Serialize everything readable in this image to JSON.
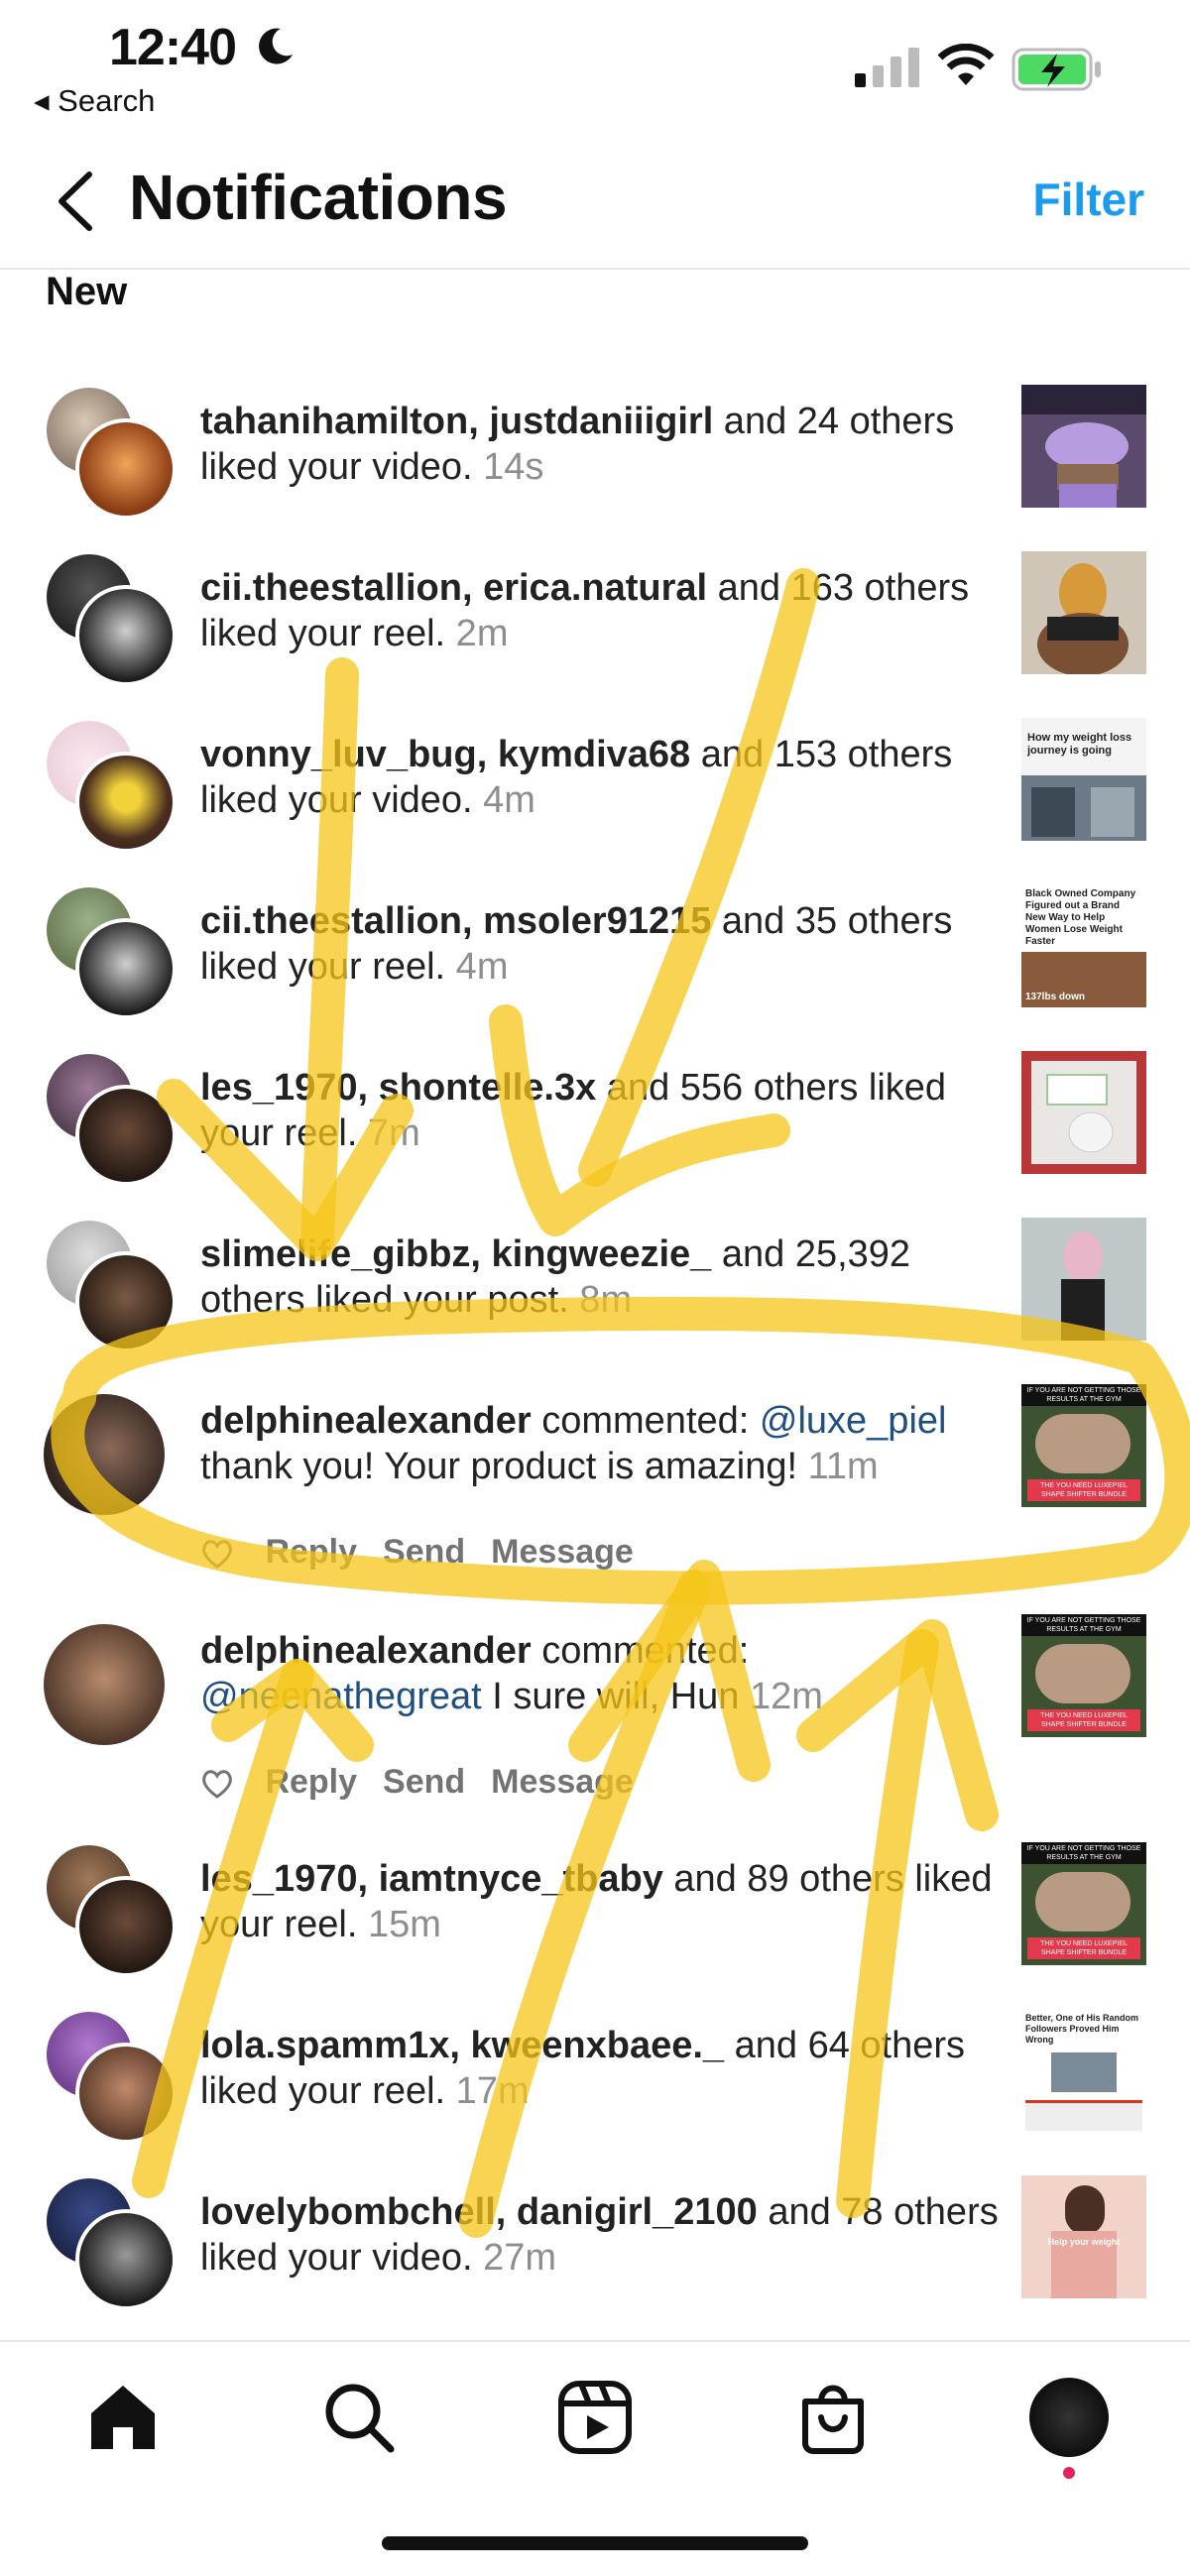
{
  "status_bar": {
    "time": "12:40",
    "back_label": "◂ Search"
  },
  "header": {
    "title": "Notifications",
    "filter": "Filter"
  },
  "section_title": "New",
  "notifications": [
    {
      "user": "tahanihamilton, justdaniiigirl",
      "text": " and 24 others liked your video.",
      "time": " 14s"
    },
    {
      "user": "cii.theestallion, erica.natural",
      "text": " and 163 others liked your reel.",
      "time": " 2m"
    },
    {
      "user": "vonny_luv_bug, kymdiva68",
      "text": " and 153 others liked your video.",
      "time": " 4m"
    },
    {
      "user": "cii.theestallion, msoler91215",
      "text": " and 35 others liked your reel.",
      "time": " 4m"
    },
    {
      "user": "les_1970, shontelle.3x",
      "text": " and 556 others liked your reel.",
      "time": " 7m"
    },
    {
      "user": "slimelife_gibbz, kingweezie_",
      "text": " and 25,392 others liked your post.",
      "time": " 8m"
    },
    {
      "user": "delphinealexander",
      "text": " commented: ",
      "mention": "@luxe_piel",
      "text2": " thank you! Your product is amazing!",
      "time": " 11m"
    },
    {
      "user": "delphinealexander",
      "text": " commented: ",
      "mention": "@neenathegreat",
      "text2": " I sure will, Hun",
      "time": " 12m"
    },
    {
      "user": "les_1970, iamtnyce_tbaby",
      "text": " and 89 others liked your reel.",
      "time": " 15m"
    },
    {
      "user": "lola.spamm1x, kweenxbaee._",
      "text": " and 64 others liked your reel.",
      "time": " 17m"
    },
    {
      "user": "lovelybombchell, danigirl_2100",
      "text": " and 78 others liked your video.",
      "time": " 27m"
    }
  ],
  "comment_actions": {
    "reply": "Reply",
    "send": "Send",
    "message": "Message"
  },
  "thumb_texts": {
    "weight_loss": "How my weight loss journey is going",
    "black_owned": "Black Owned Company Figured out a Brand New Way to Help Women Lose Weight Faster",
    "black_owned_sub": "137lbs down",
    "gym_top": "IF YOU ARE NOT GETTING THOSE RESULTS AT THE GYM",
    "gym_bottom": "THE YOU NEED LUXEPIEL SHAPE SHIFTER BUNDLE",
    "news": "Better, One of His Random Followers Proved Him Wrong",
    "pink_caption": "Help your weight"
  },
  "colors": {
    "accent": "#1a9bf0",
    "highlighter": "#f5c518",
    "battery_green": "#4cd964"
  },
  "icons": [
    "home-icon",
    "search-icon",
    "reels-icon",
    "shop-icon",
    "profile-avatar"
  ]
}
